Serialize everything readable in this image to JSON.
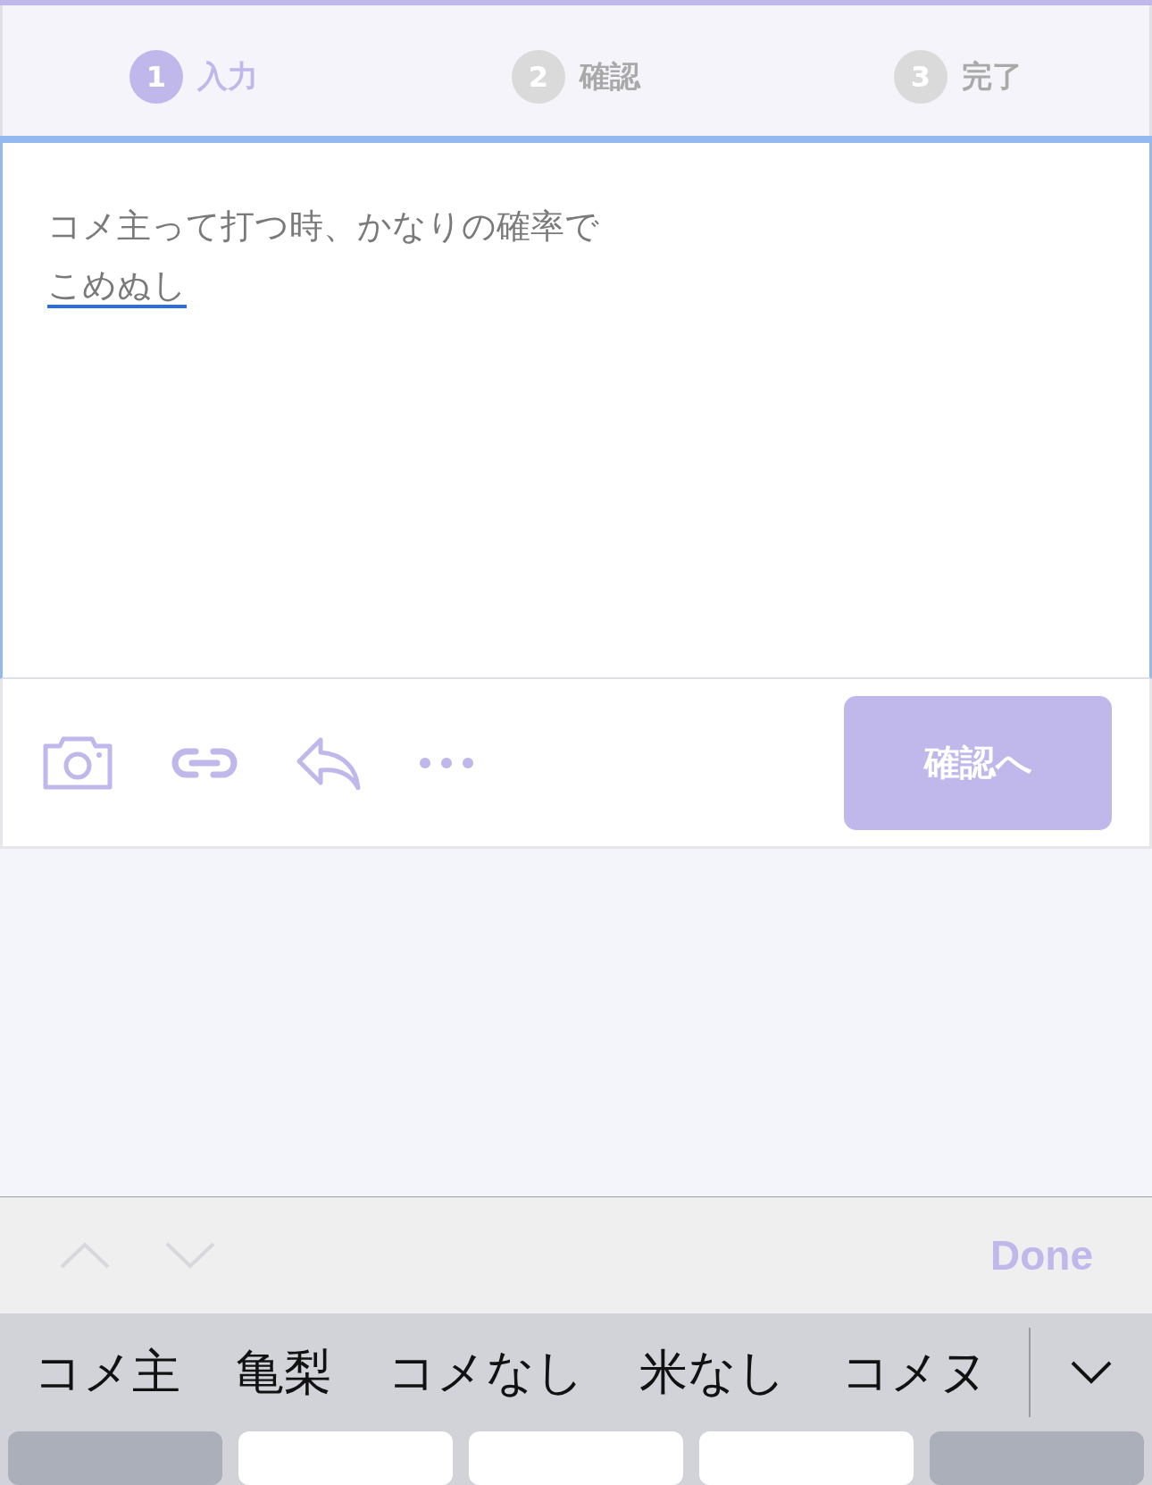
{
  "steps": [
    {
      "number": "1",
      "label": "入力",
      "selected": true
    },
    {
      "number": "2",
      "label": "確認",
      "selected": false
    },
    {
      "number": "3",
      "label": "完了",
      "selected": false
    }
  ],
  "editor": {
    "lines": [
      {
        "text": "コメ主って打つ時、かなりの確率で",
        "kind": "committed"
      },
      {
        "text": "こめぬし",
        "kind": "composing"
      }
    ]
  },
  "toolbar": {
    "icons": [
      {
        "kind": "camera"
      },
      {
        "kind": "link"
      },
      {
        "kind": "reply"
      },
      {
        "kind": "more"
      }
    ],
    "submit": "確認へ"
  },
  "keyboard": {
    "done": "Done",
    "candidates": [
      "コメ主",
      "亀梨",
      "コメなし",
      "米なし",
      "コメヌ"
    ],
    "keys": [
      {
        "kind": "function"
      },
      {
        "kind": "letter"
      },
      {
        "kind": "letter"
      },
      {
        "kind": "letter"
      },
      {
        "kind": "function"
      }
    ]
  }
}
